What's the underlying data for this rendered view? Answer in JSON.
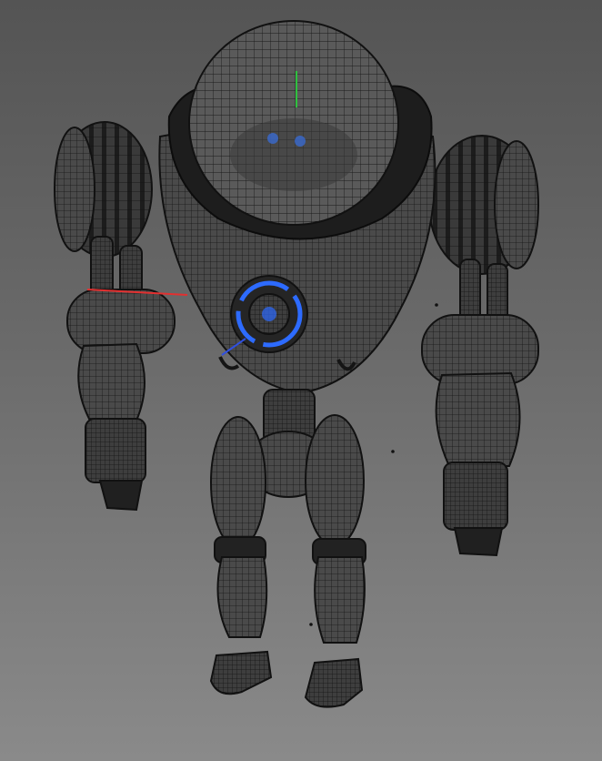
{
  "viewport": {
    "mode": "wireframe-on-shaded",
    "background_gradient": [
      "#545454",
      "#8a8a8a"
    ],
    "wireframe_color": "#101010",
    "shaded_color": "#4a4a4a"
  },
  "model": {
    "subject": "robot",
    "accent_color": "#2d6bff"
  },
  "manipulator": {
    "x_axis_color": "#e23030",
    "y_axis_color": "#30c040",
    "z_axis_color": "#3050e0"
  }
}
